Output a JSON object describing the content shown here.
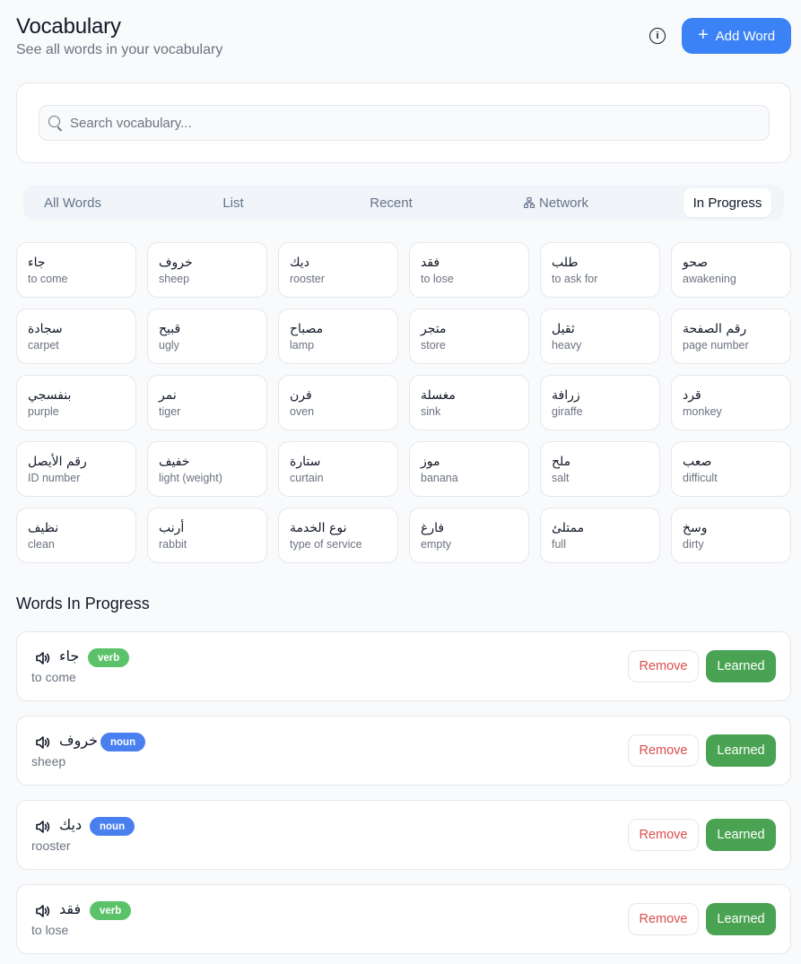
{
  "header": {
    "title": "Vocabulary",
    "subtitle": "See all words in your vocabulary",
    "add_label": "Add Word"
  },
  "search": {
    "placeholder": "Search vocabulary..."
  },
  "tabs": [
    {
      "label": "All Words"
    },
    {
      "label": "List"
    },
    {
      "label": "Recent"
    },
    {
      "label": "Network"
    },
    {
      "label": "In Progress",
      "active": true
    }
  ],
  "words": [
    {
      "ar": "جاء",
      "en": "to come"
    },
    {
      "ar": "خروف",
      "en": "sheep"
    },
    {
      "ar": "ديك",
      "en": "rooster"
    },
    {
      "ar": "فقد",
      "en": "to lose"
    },
    {
      "ar": "طلب",
      "en": "to ask for"
    },
    {
      "ar": "صحو",
      "en": "awakening"
    },
    {
      "ar": "سجادة",
      "en": "carpet"
    },
    {
      "ar": "قبيح",
      "en": "ugly"
    },
    {
      "ar": "مصباح",
      "en": "lamp"
    },
    {
      "ar": "متجر",
      "en": "store"
    },
    {
      "ar": "ثقيل",
      "en": "heavy"
    },
    {
      "ar": "رقم الصفحة",
      "en": "page number"
    },
    {
      "ar": "بنفسجي",
      "en": "purple"
    },
    {
      "ar": "نمر",
      "en": "tiger"
    },
    {
      "ar": "فرن",
      "en": "oven"
    },
    {
      "ar": "مغسلة",
      "en": "sink"
    },
    {
      "ar": "زرافة",
      "en": "giraffe"
    },
    {
      "ar": "قرد",
      "en": "monkey"
    },
    {
      "ar": "رقم الأيصل",
      "en": "ID number"
    },
    {
      "ar": "خفيف",
      "en": "light (weight)"
    },
    {
      "ar": "ستارة",
      "en": "curtain"
    },
    {
      "ar": "موز",
      "en": "banana"
    },
    {
      "ar": "ملح",
      "en": "salt"
    },
    {
      "ar": "صعب",
      "en": "difficult"
    },
    {
      "ar": "نظيف",
      "en": "clean"
    },
    {
      "ar": "أرنب",
      "en": "rabbit"
    },
    {
      "ar": "نوع الخدمة",
      "en": "type of service"
    },
    {
      "ar": "فارغ",
      "en": "empty"
    },
    {
      "ar": "ممتلئ",
      "en": "full"
    },
    {
      "ar": "وسخ",
      "en": "dirty"
    }
  ],
  "in_progress": {
    "title": "Words In Progress",
    "remove_label": "Remove",
    "learned_label": "Learned",
    "items": [
      {
        "ar": "جاء",
        "en": "to come",
        "type": "verb"
      },
      {
        "ar": "خروف",
        "en": "sheep",
        "type": "noun"
      },
      {
        "ar": "ديك",
        "en": "rooster",
        "type": "noun"
      },
      {
        "ar": "فقد",
        "en": "to lose",
        "type": "verb"
      }
    ]
  },
  "colors": {
    "accent": "#3b82f6",
    "verb_badge": "#5cc26a",
    "noun_badge": "#4a7ff0",
    "learned": "#4aa352",
    "remove_text": "#dc4e4e"
  }
}
